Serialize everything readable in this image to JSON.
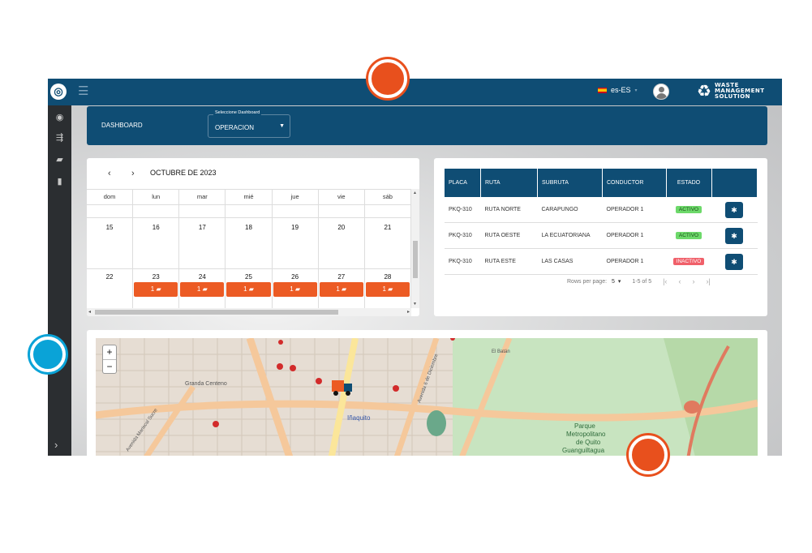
{
  "topbar": {
    "lang_label": "es-ES",
    "brand_line1": "WASTE",
    "brand_line2": "MANAGEMENT",
    "brand_line3": "SOLUTION"
  },
  "dashboard": {
    "title": "DASHBOARD",
    "select_label": "Seleccione Dashboard",
    "select_value": "OPERACION"
  },
  "calendar": {
    "month": "OCTUBRE DE 2023",
    "weekdays": [
      "dom",
      "lun",
      "mar",
      "mié",
      "jue",
      "vie",
      "sáb"
    ],
    "week1": [
      "15",
      "16",
      "17",
      "18",
      "19",
      "20",
      "21"
    ],
    "week2": [
      "22",
      "23",
      "24",
      "25",
      "26",
      "27",
      "28"
    ],
    "event_label": "1"
  },
  "table": {
    "headers": [
      "PLACA",
      "RUTA",
      "SUBRUTA",
      "CONDUCTOR",
      "ESTADO",
      ""
    ],
    "rows": [
      {
        "placa": "PKQ-310",
        "ruta": "RUTA NORTE",
        "subruta": "CARAPUNGO",
        "conductor": "OPERADOR 1",
        "estado": "ACTIVO"
      },
      {
        "placa": "PKQ-310",
        "ruta": "RUTA OESTE",
        "subruta": "LA ECUATORIANA",
        "conductor": "OPERADOR 1",
        "estado": "ACTIVO"
      },
      {
        "placa": "PKQ-310",
        "ruta": "RUTA ESTE",
        "subruta": "LAS CASAS",
        "conductor": "OPERADOR 1",
        "estado": "INACTIVO"
      }
    ],
    "rows_per_page_label": "Rows per page:",
    "rows_per_page_value": "5",
    "range": "1-5 of 5"
  },
  "map": {
    "labels": {
      "granda": "Granda Centeno",
      "inaquito": "Iñaquito",
      "parque1": "Parque",
      "parque2": "Metropolitano",
      "parque3": "de Quito",
      "parque4": "Guanguiltagua",
      "av_diciembre": "Avenida 6 de Diciembre",
      "av_mariscal": "Avenida Mariscal Sucre",
      "el_batan": "El Batán"
    },
    "zoom_in": "+",
    "zoom_out": "−"
  },
  "colors": {
    "primary": "#0f4d74",
    "accent": "#ec5b24",
    "active": "#6dd96a",
    "inactive": "#f0606a"
  }
}
